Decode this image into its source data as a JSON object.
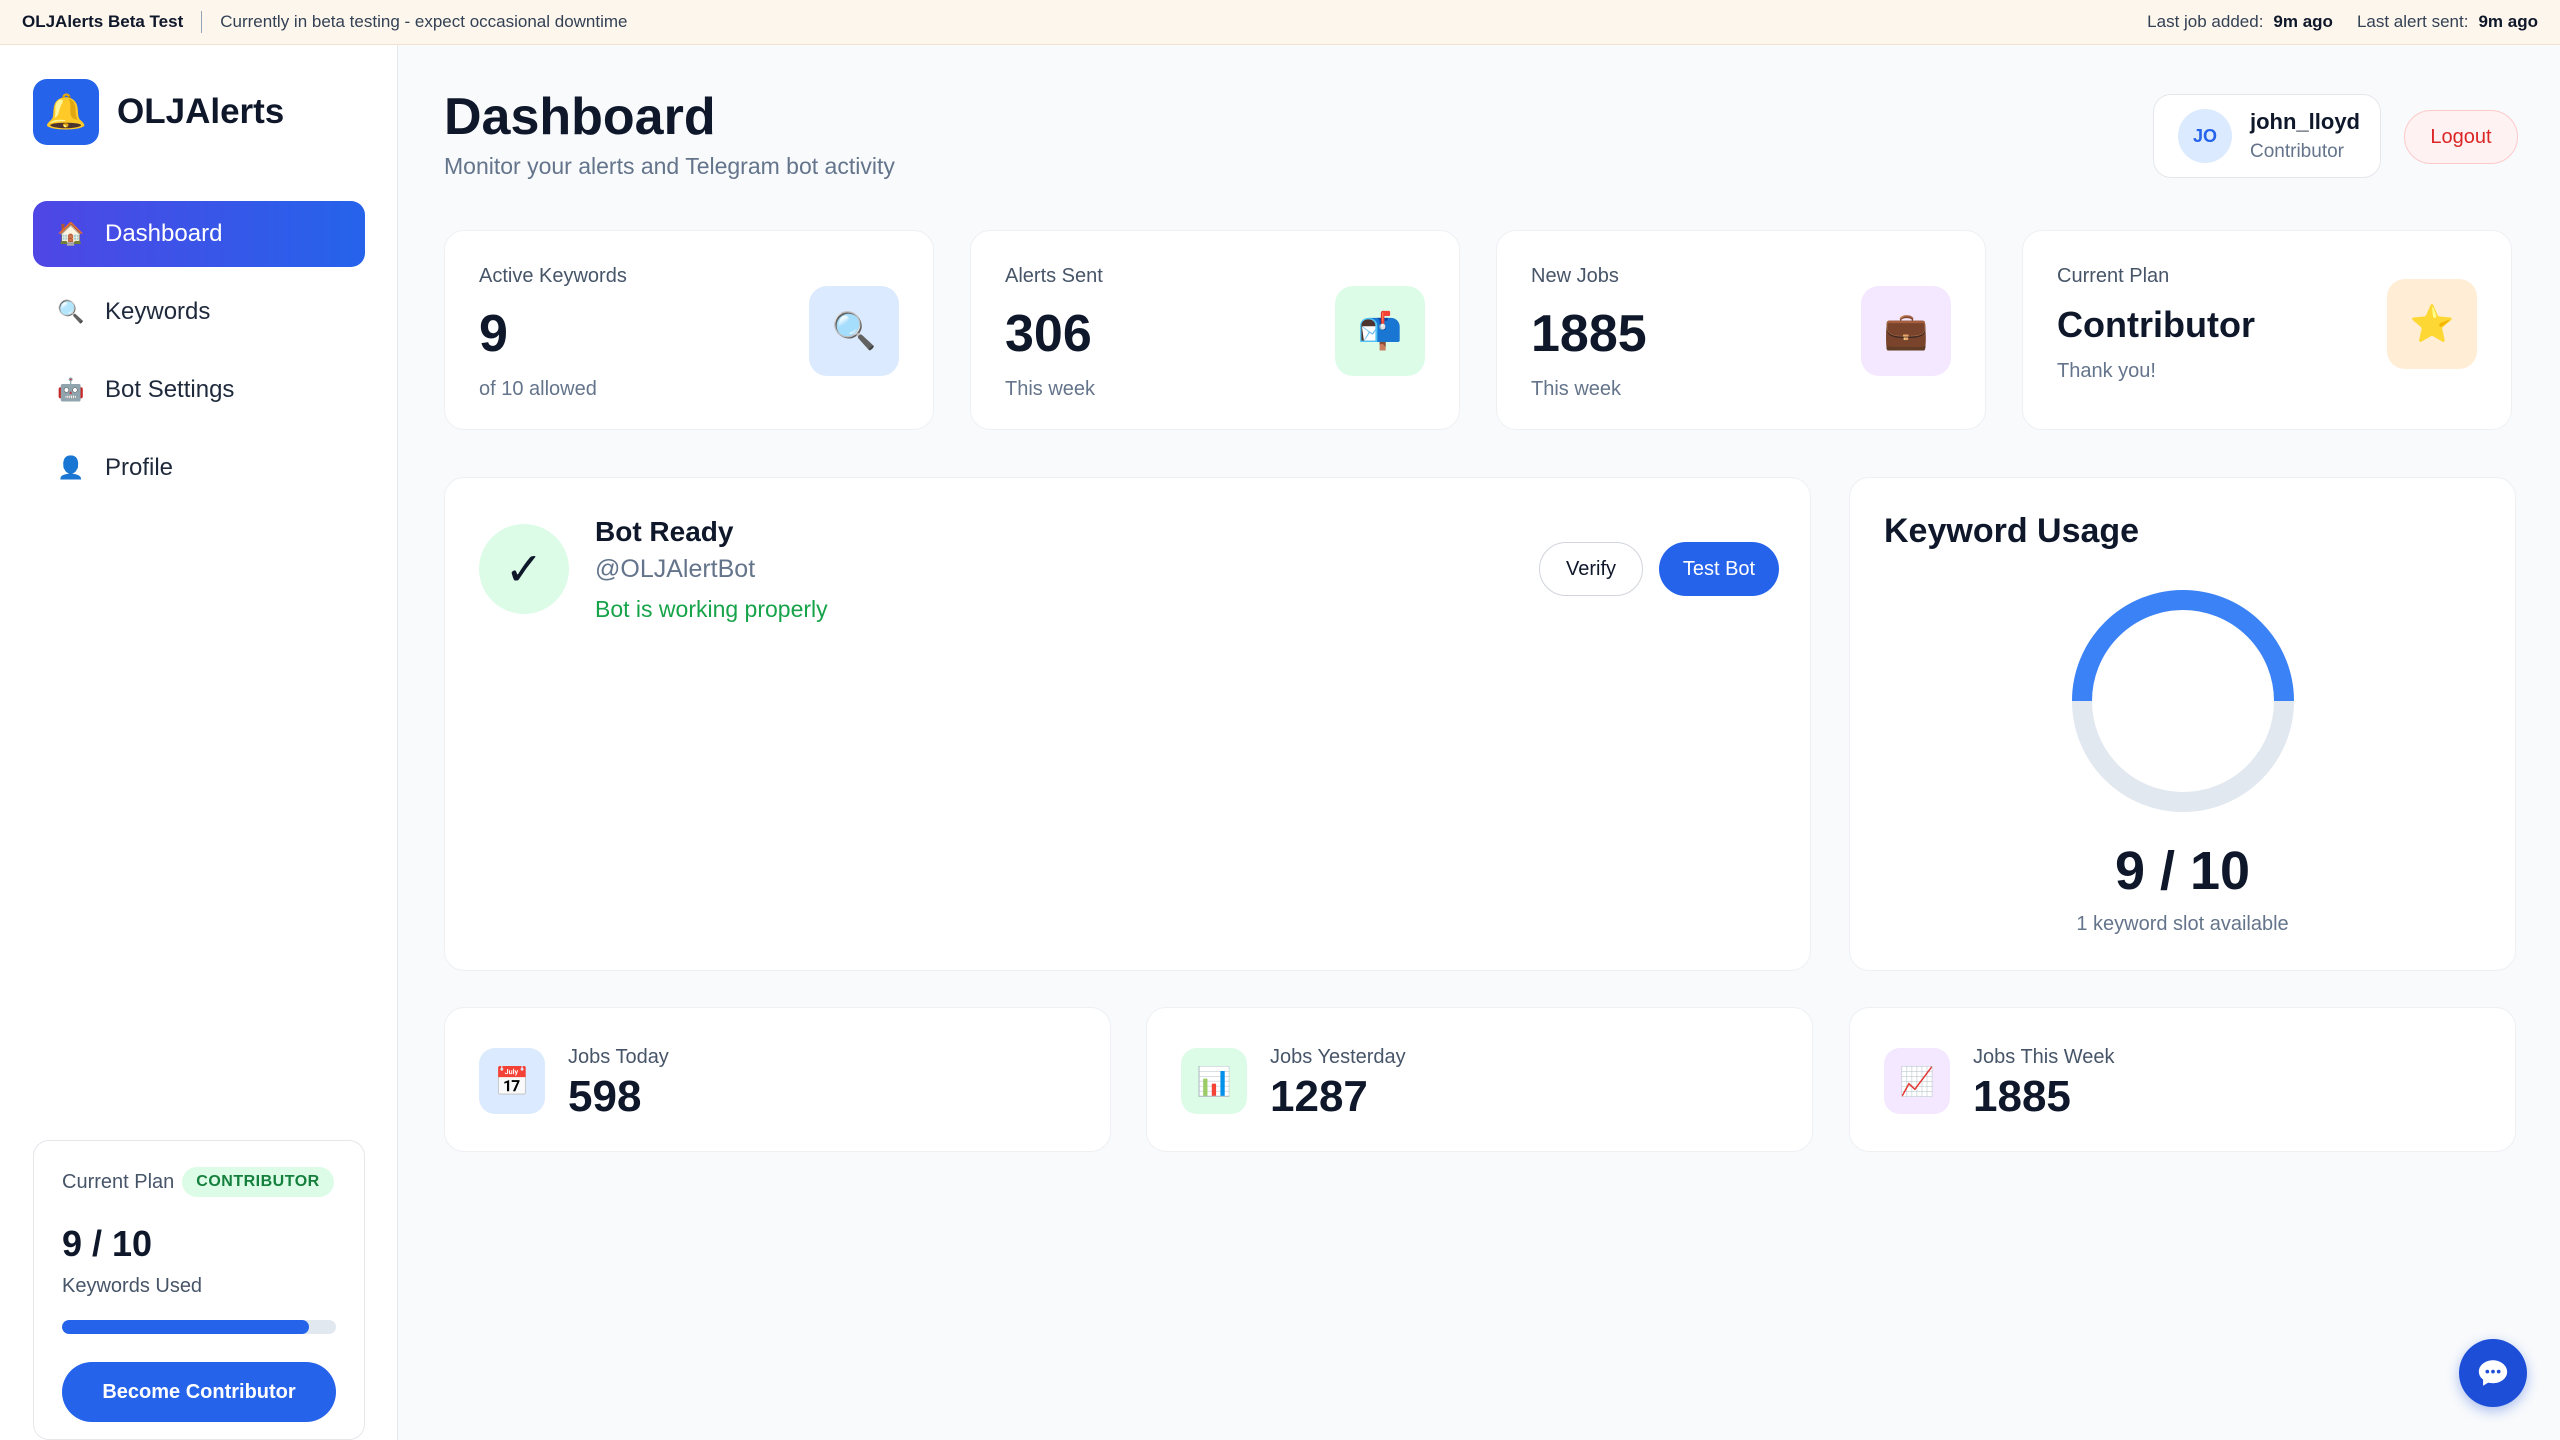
{
  "banner": {
    "title": "OLJAlerts Beta Test",
    "message": "Currently in beta testing - expect occasional downtime",
    "last_job_label": "Last job added:",
    "last_job_value": "9m ago",
    "last_alert_label": "Last alert sent:",
    "last_alert_value": "9m ago"
  },
  "sidebar": {
    "brand_icon": "bell-icon",
    "brand_name": "OLJAlerts",
    "items": [
      {
        "label": "Dashboard",
        "icon": "house-icon",
        "glyph": "🏠",
        "active": true
      },
      {
        "label": "Keywords",
        "icon": "magnifier-icon",
        "glyph": "🔍",
        "active": false
      },
      {
        "label": "Bot Settings",
        "icon": "robot-icon",
        "glyph": "🤖",
        "active": false
      },
      {
        "label": "Profile",
        "icon": "person-icon",
        "glyph": "👤",
        "active": false
      }
    ],
    "plan": {
      "label": "Current Plan",
      "badge": "CONTRIBUTOR",
      "usage": "9 / 10",
      "usage_label": "Keywords Used",
      "progress_fraction": 0.9,
      "button": "Become Contributor"
    }
  },
  "header": {
    "title": "Dashboard",
    "subtitle": "Monitor your alerts and Telegram bot activity",
    "user": {
      "initials": "JO",
      "name": "john_lloyd",
      "role": "Contributor"
    },
    "logout": "Logout"
  },
  "stats": [
    {
      "label": "Active Keywords",
      "value": "9",
      "sub": "of 10 allowed",
      "icon": "magnifier-icon",
      "glyph": "🔍",
      "tint": "#dbeafe"
    },
    {
      "label": "Alerts Sent",
      "value": "306",
      "sub": "This week",
      "icon": "mailbox-icon",
      "glyph": "📬",
      "tint": "#dcfce7"
    },
    {
      "label": "New Jobs",
      "value": "1885",
      "sub": "This week",
      "icon": "briefcase-icon",
      "glyph": "💼",
      "tint": "#f3e8ff"
    },
    {
      "label": "Current Plan",
      "value": "Contributor",
      "sub": "Thank you!",
      "icon": "star-icon",
      "glyph": "⭐",
      "tint": "#ffedd5"
    }
  ],
  "bot": {
    "title": "Bot Ready",
    "handle": "@OLJAlertBot",
    "status": "Bot is working properly",
    "verify": "Verify",
    "test": "Test Bot",
    "check_glyph": "✓"
  },
  "usage": {
    "title": "Keyword Usage",
    "value": "9 / 10",
    "available": "1 keyword slot available",
    "used": 9,
    "total": 10,
    "ring_color": "#3b82f6",
    "track_color": "#e2e8f0"
  },
  "jobs": [
    {
      "label": "Jobs Today",
      "value": "598",
      "icon": "calendar-icon",
      "glyph": "📅",
      "tint": "#dbeafe"
    },
    {
      "label": "Jobs Yesterday",
      "value": "1287",
      "icon": "bar-chart-icon",
      "glyph": "📊",
      "tint": "#dcfce7"
    },
    {
      "label": "Jobs This Week",
      "value": "1885",
      "icon": "trend-chart-icon",
      "glyph": "📈",
      "tint": "#f3e8ff"
    }
  ],
  "chat": {
    "icon": "chat-bubble-icon"
  }
}
